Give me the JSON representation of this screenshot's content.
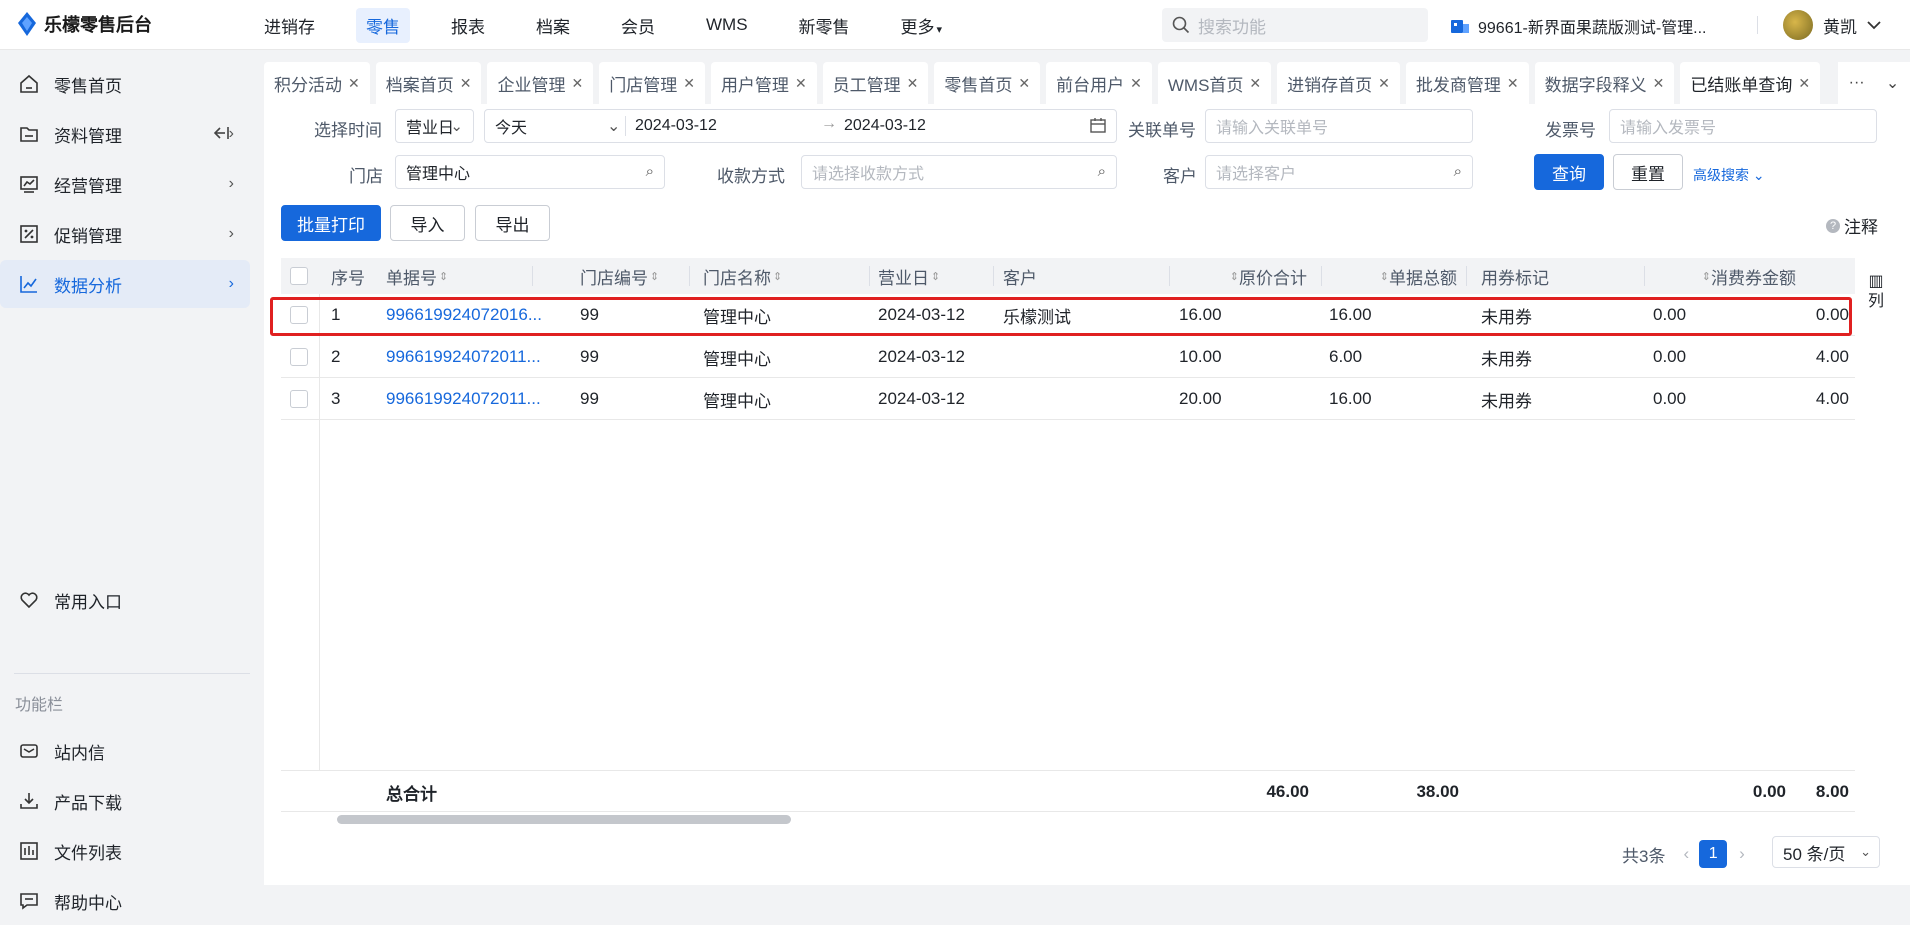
{
  "app": {
    "title": "乐檬零售后台"
  },
  "topnav": {
    "items": [
      "进销存",
      "零售",
      "报表",
      "档案",
      "会员",
      "WMS",
      "新零售",
      "更多"
    ],
    "active_index": 1,
    "search_placeholder": "搜索功能",
    "store": "99661-新界面果蔬版测试-管理...",
    "user": "黄凯"
  },
  "sidebar": {
    "items": [
      {
        "label": "零售首页",
        "icon": "home-icon"
      },
      {
        "label": "资料管理",
        "icon": "folder-icon"
      },
      {
        "label": "经营管理",
        "icon": "chart-icon"
      },
      {
        "label": "促销管理",
        "icon": "promotion-icon"
      },
      {
        "label": "数据分析",
        "icon": "analytics-icon"
      }
    ],
    "active_index": 4,
    "favorites_label": "常用入口",
    "section_label": "功能栏",
    "bottom_items": [
      {
        "label": "站内信",
        "icon": "mail-icon"
      },
      {
        "label": "产品下载",
        "icon": "download-icon"
      },
      {
        "label": "文件列表",
        "icon": "file-list-icon"
      },
      {
        "label": "帮助中心",
        "icon": "help-icon"
      }
    ]
  },
  "tabs": [
    "积分活动",
    "档案首页",
    "企业管理",
    "门店管理",
    "用户管理",
    "员工管理",
    "零售首页",
    "前台用户",
    "WMS首页",
    "进销存首页",
    "批发商管理",
    "数据字段释义",
    "已结账单查询"
  ],
  "active_tab": "已结账单查询",
  "filters": {
    "time_label": "选择时间",
    "time_type": "营业日",
    "time_range": "今天",
    "date_start": "2024-03-12",
    "date_end": "2024-03-12",
    "ref_label": "关联单号",
    "ref_placeholder": "请输入关联单号",
    "invoice_label": "发票号",
    "invoice_placeholder": "请输入发票号",
    "store_label": "门店",
    "store_value": "管理中心",
    "payment_label": "收款方式",
    "payment_placeholder": "请选择收款方式",
    "customer_label": "客户",
    "customer_placeholder": "请选择客户",
    "query": "查询",
    "reset": "重置",
    "advanced": "高级搜索"
  },
  "actions": {
    "batch_print": "批量打印",
    "import": "导入",
    "export": "导出",
    "note": "注释"
  },
  "table": {
    "columns": [
      "序号",
      "单据号",
      "门店编号",
      "门店名称",
      "营业日",
      "客户",
      "原价合计",
      "单据总额",
      "用券标记",
      "消费券金额"
    ],
    "rows": [
      [
        "1",
        "996619924072016...",
        "99",
        "管理中心",
        "2024-03-12",
        "乐檬测试",
        "16.00",
        "16.00",
        "未用券",
        "0.00",
        "0.00"
      ],
      [
        "2",
        "996619924072011...",
        "99",
        "管理中心",
        "2024-03-12",
        "",
        "10.00",
        "6.00",
        "未用券",
        "0.00",
        "4.00"
      ],
      [
        "3",
        "996619924072011...",
        "99",
        "管理中心",
        "2024-03-12",
        "",
        "20.00",
        "16.00",
        "未用券",
        "0.00",
        "4.00"
      ]
    ],
    "total_label": "总合计",
    "totals": [
      "46.00",
      "38.00",
      "0.00",
      "8.00"
    ],
    "column_toggle": "列"
  },
  "pager": {
    "total": "共3条",
    "page": "1",
    "page_size": "50 条/页"
  }
}
